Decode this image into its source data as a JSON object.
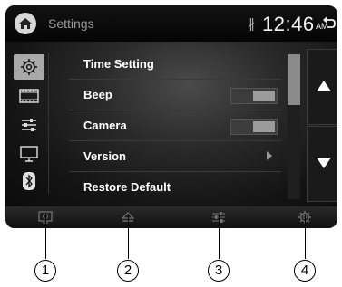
{
  "header": {
    "title": "Settings",
    "clock": "12:46",
    "ampm": "AM",
    "bluetooth_glyph": "∦"
  },
  "sidebar": {
    "items": [
      {
        "icon": "gear-icon",
        "active": true
      },
      {
        "icon": "film-icon",
        "active": false
      },
      {
        "icon": "sliders-icon",
        "active": false
      },
      {
        "icon": "monitor-icon",
        "active": false
      },
      {
        "icon": "bluetooth-icon",
        "active": false
      }
    ]
  },
  "menu": {
    "items": [
      {
        "label": "Time Setting",
        "control": "none"
      },
      {
        "label": "Beep",
        "control": "toggle"
      },
      {
        "label": "Camera",
        "control": "toggle"
      },
      {
        "label": "Version",
        "control": "arrow"
      },
      {
        "label": "Restore Default",
        "control": "none"
      }
    ]
  },
  "bottombar": {
    "items": [
      {
        "icon": "display-icon"
      },
      {
        "icon": "eject-icon"
      },
      {
        "icon": "sliders-icon"
      },
      {
        "icon": "gear-icon"
      }
    ]
  },
  "callouts": [
    "1",
    "2",
    "3",
    "4"
  ],
  "colors": {
    "screen_bg": "#0b0b0b",
    "active_tab": "#a8a8a8",
    "text": "#ffffff"
  }
}
